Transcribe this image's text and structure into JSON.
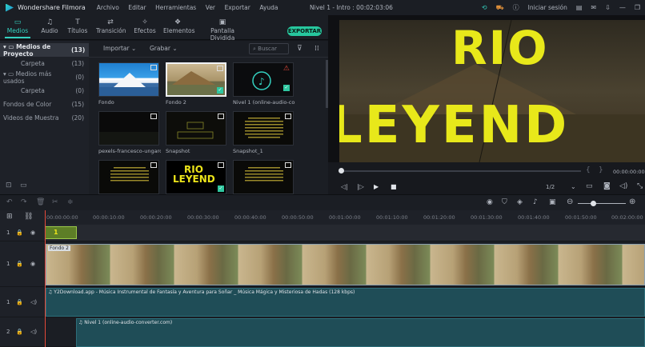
{
  "app": {
    "name": "Wondershare Filmora",
    "menu": [
      "Archivo",
      "Editar",
      "Herramientas",
      "Ver",
      "Exportar",
      "Ayuda"
    ],
    "project_title": "Nivel 1 - Intro : 00:02:03:06",
    "login": "Iniciar sesión"
  },
  "toolbar": {
    "tabs": [
      {
        "label": "Medios",
        "icon": "folder-icon"
      },
      {
        "label": "Audio",
        "icon": "music-icon"
      },
      {
        "label": "Títulos",
        "icon": "text-icon"
      },
      {
        "label": "Transición",
        "icon": "transition-icon"
      },
      {
        "label": "Efectos",
        "icon": "effects-icon"
      },
      {
        "label": "Elementos",
        "icon": "elements-icon"
      },
      {
        "label": "Pantalla Dividida",
        "icon": "split-screen-icon"
      }
    ],
    "export_label": "EXPORTAR"
  },
  "tree": {
    "items": [
      {
        "label": "Medios de Proyecto",
        "count": "(13)"
      },
      {
        "label": "Carpeta",
        "count": "(13)"
      },
      {
        "label": "Medios más usados",
        "count": "(0)"
      },
      {
        "label": "Carpeta",
        "count": "(0)"
      },
      {
        "label": "Fondos de Color",
        "count": "(15)"
      },
      {
        "label": "Videos de Muestra",
        "count": "(20)"
      }
    ]
  },
  "media": {
    "import_label": "Importar",
    "record_label": "Grabar",
    "search_placeholder": "Buscar",
    "items": [
      {
        "caption": "Fondo"
      },
      {
        "caption": "Fondo 2"
      },
      {
        "caption": "Nivel 1 (online-audio-con..."
      },
      {
        "caption": "pexels-francesco-ungaro-..."
      },
      {
        "caption": "Snapshot"
      },
      {
        "caption": "Snapshot_1"
      },
      {
        "caption": ""
      },
      {
        "caption": ""
      },
      {
        "caption": ""
      }
    ],
    "logo_line1": "RIO",
    "logo_line2": "LEYEND"
  },
  "preview": {
    "title_top": "RIO",
    "title_bottom": "LEYEND",
    "timecode": "00:00:00:00",
    "page": "1/2",
    "progress": 0.0
  },
  "timeline": {
    "ticks": [
      "00:00:00:00",
      "00:00:10:00",
      "00:00:20:00",
      "00:00:30:00",
      "00:00:40:00",
      "00:00:50:00",
      "00:01:00:00",
      "00:01:10:00",
      "00:01:20:00",
      "00:01:30:00",
      "00:01:40:00",
      "00:01:50:00",
      "00:02:00:00"
    ],
    "clip_title": "1",
    "video_clip_name": "Fondo 2",
    "audio1": "Y2Download.app - Música Instrumental de Fantasía y Aventura para Soñar _ Música Mágica y Misteriosa de Hadas (128 kbps)",
    "audio2": "Nivel 1 (online-audio-converter.com)",
    "track_labels": {
      "t1": "1",
      "t2": "1",
      "a1": "1",
      "a2": "2"
    }
  },
  "colors": {
    "accent": "#34d1c0",
    "export": "#27c79e",
    "playhead": "#e64a3b",
    "title_yellow": "#e8e81a",
    "audio_lane": "#1f4d57"
  }
}
